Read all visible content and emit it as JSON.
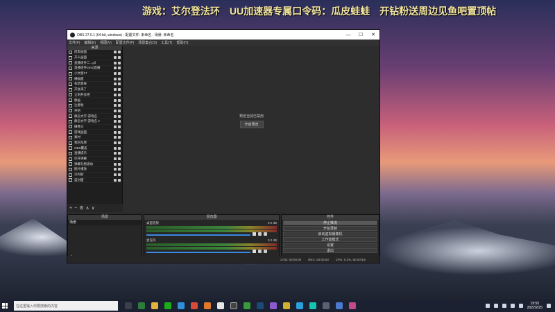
{
  "banner": "游戏：艾尔登法环　UU加速器专属口令码：瓜皮蛙蛙　开钻粉送周边见鱼吧置顶帖",
  "window": {
    "title": "OBS 27.0.1 (64-bit, windows) - 配置文件: 未命名 - 场景: 未命名",
    "minimize": "—",
    "maximize": "☐",
    "close": "✕"
  },
  "menu": [
    "文件(F)",
    "编辑(E)",
    "视图(V)",
    "配置文件(P)",
    "场景集合(S)",
    "工具(T)",
    "帮助(H)"
  ],
  "sources": {
    "title": "来源",
    "items": [
      "结束画面",
      "开头画面",
      "直播组件二...gif",
      "直播组件(nnn)直播",
      "小文窗17",
      "横幅面",
      "有新景来",
      "开会来了",
      "立刻开会吧",
      "静画",
      "注意啦",
      "开始",
      "静态文字-游戏名",
      "静态文字-游戏名 2",
      "摄像头",
      "游戏画面",
      "素材",
      "我的车牌",
      "OBS覆盖",
      "直播提示",
      "打开弹幕",
      "弹幕礼物滚动",
      "图片播放",
      "贝利斯",
      "蓝封面"
    ]
  },
  "preview": {
    "message": "预览当前已禁用",
    "button": "开启预览"
  },
  "scenes": {
    "title": "场景",
    "item": "场景"
  },
  "mixer": {
    "title": "混音器",
    "channels": [
      {
        "name": "桌面音频",
        "db": "0.0 dB"
      },
      {
        "name": "麦克风",
        "db": "0.0 dB"
      }
    ]
  },
  "controls": {
    "title": "控件",
    "buttons": [
      "停止推流",
      "开始录制",
      "启动虚拟摄像机",
      "工作室模式",
      "设置",
      "退出"
    ]
  },
  "status": {
    "live": "LIVE: 00:00:00",
    "rec": "REC: 00:00:00",
    "cpu": "CPU: 0.2%, 60.00 fps"
  },
  "taskbar": {
    "search_placeholder": "在这里输入你要搜索的内容",
    "time": "19:55",
    "date": "2022/2/25"
  },
  "colors": {
    "accent": "#3c8ae0",
    "banner_text": "#f4e7a0",
    "taskbar": "#1b2130"
  }
}
